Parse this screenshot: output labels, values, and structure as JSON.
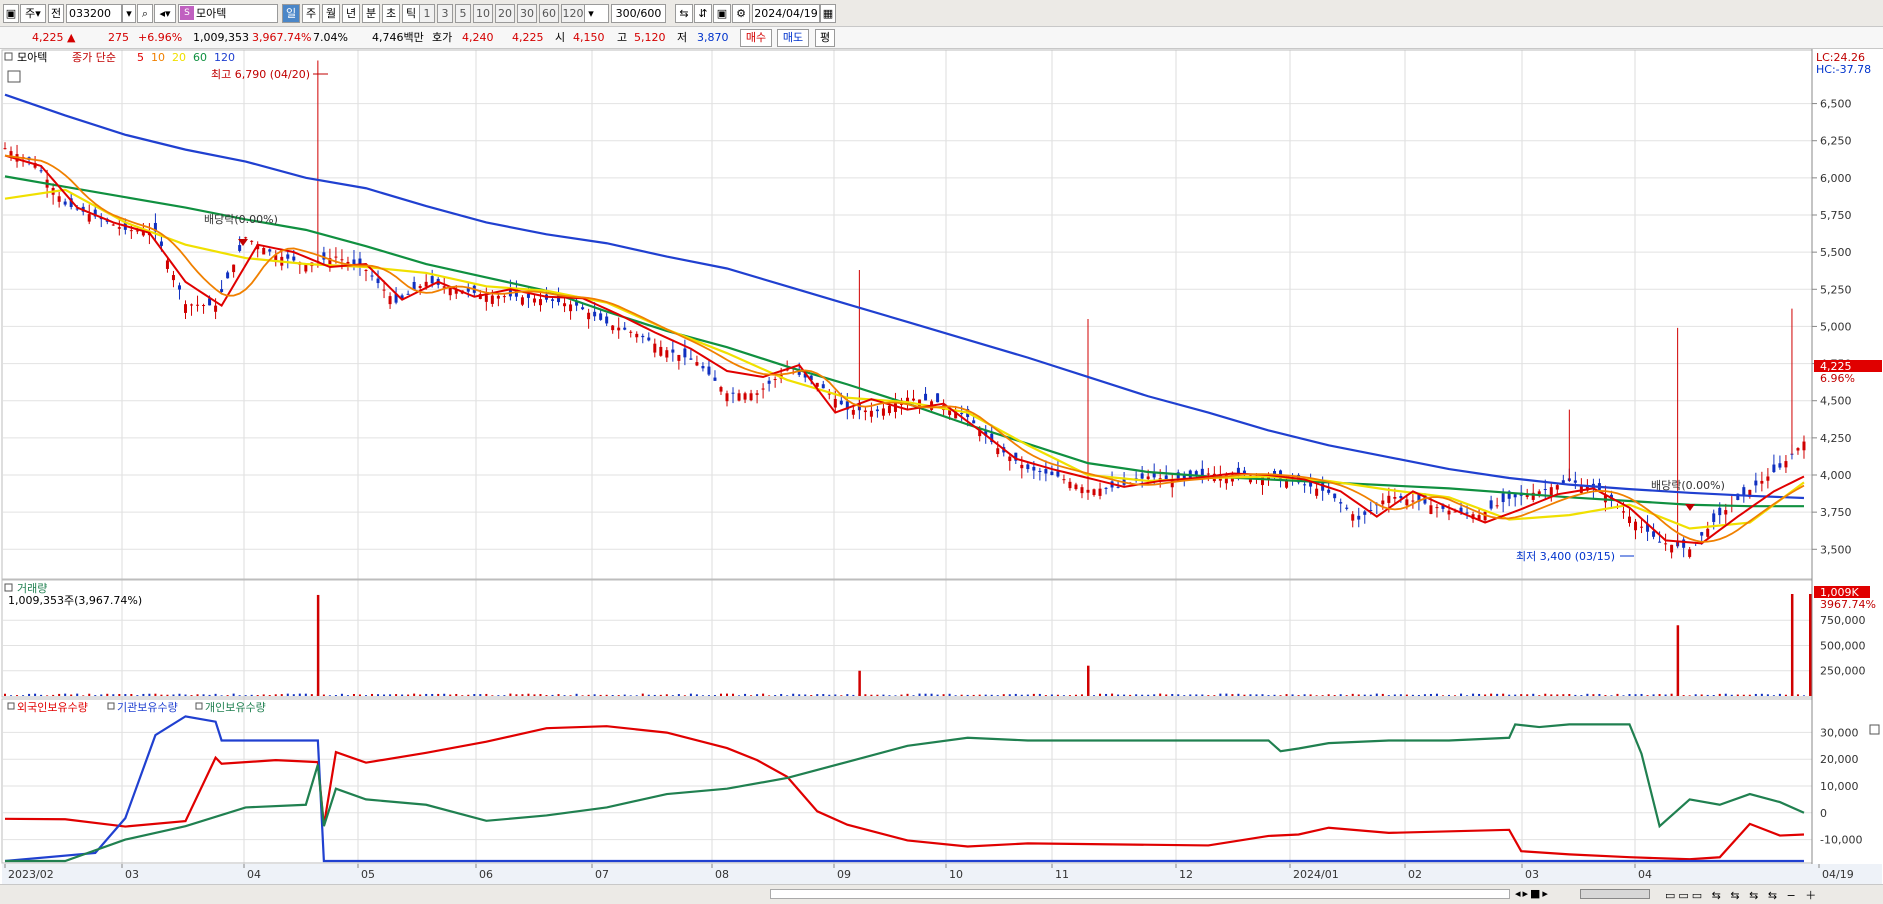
{
  "toolbar": {
    "period_type": "주",
    "all_label": "전",
    "code": "033200",
    "stock_name": "모아텍",
    "periods": [
      "일",
      "주",
      "월",
      "년",
      "분",
      "초",
      "틱"
    ],
    "active_period": "일",
    "intervals": [
      "1",
      "3",
      "5",
      "10",
      "20",
      "30",
      "60",
      "120"
    ],
    "count": "300/600",
    "date": "2024/04/19"
  },
  "info": {
    "price": "4,225",
    "change": "275",
    "change_pct": "+6.96%",
    "volume": "1,009,353",
    "volume_pct": "3,967.74%",
    "turnover": "7.04%",
    "amount": "4,746백만",
    "quote_label": "호가",
    "ask": "4,240",
    "bid": "4,225",
    "open_label": "시",
    "open": "4,150",
    "high_label": "고",
    "high": "5,120",
    "low_label": "저",
    "low": "3,870",
    "buy_label": "매수",
    "sell_label": "매도",
    "eval_label": "평"
  },
  "price_panel": {
    "stock": "모아텍",
    "ma_title": "종가 단순",
    "ma_periods": [
      "5",
      "10",
      "20",
      "60",
      "120"
    ],
    "ma_colors": [
      "#e00000",
      "#f08000",
      "#f0e000",
      "#109040",
      "#2040d0"
    ],
    "lc": "LC:24.26",
    "hc": "HC:-37.78",
    "current_tag": "4,225",
    "current_pct": "6.96%",
    "high_annot": "최고 6,790 (04/20)",
    "low_annot": "최저 3,400 (03/15)",
    "dividend1": "배당락(0.00%)",
    "dividend2": "배당락(0.00%)"
  },
  "volume_panel": {
    "title": "거래량",
    "subtitle": "1,009,353주(3,967.74%)",
    "current_tag": "1,009K",
    "current_pct": "3967.74%"
  },
  "holding_panel": {
    "legend": [
      "외국인보유수량",
      "기관보유수량",
      "개인보유수량"
    ],
    "colors": [
      "#e00000",
      "#2040d0",
      "#208050"
    ]
  },
  "chart_data": [
    {
      "type": "line",
      "title": "모아텍",
      "y_ticks": [
        "6,500",
        "6,250",
        "6,000",
        "5,750",
        "5,500",
        "5,250",
        "5,000",
        "4,750",
        "4,500",
        "4,250",
        "4,000",
        "3,750",
        "3,500"
      ],
      "ylim": [
        3300,
        6800
      ],
      "x_labels": [
        "2023/02",
        "03",
        "04",
        "05",
        "06",
        "07",
        "08",
        "09",
        "10",
        "11",
        "12",
        "2024/01",
        "02",
        "03",
        "04",
        "04/19"
      ],
      "series": [
        {
          "name": "120",
          "x": [
            0,
            10,
            20,
            30,
            40,
            50,
            60,
            70,
            80,
            90,
            100,
            110,
            120,
            130,
            140,
            150,
            160,
            170,
            180,
            190,
            200,
            210,
            220,
            230,
            240,
            250,
            260,
            270,
            280,
            290,
            299
          ],
          "values": [
            6560,
            6420,
            6290,
            6190,
            6110,
            6000,
            5930,
            5810,
            5700,
            5620,
            5560,
            5470,
            5390,
            5270,
            5150,
            5030,
            4910,
            4790,
            4660,
            4530,
            4420,
            4300,
            4200,
            4120,
            4040,
            3980,
            3935,
            3905,
            3880,
            3860,
            3845
          ]
        },
        {
          "name": "60",
          "x": [
            0,
            10,
            20,
            30,
            40,
            50,
            60,
            70,
            80,
            90,
            100,
            110,
            120,
            130,
            140,
            150,
            160,
            170,
            180,
            190,
            200,
            210,
            220,
            230,
            240,
            250,
            260,
            270,
            280,
            290,
            299
          ],
          "values": [
            6010,
            5940,
            5870,
            5800,
            5720,
            5650,
            5540,
            5420,
            5330,
            5240,
            5100,
            4970,
            4860,
            4730,
            4610,
            4480,
            4340,
            4210,
            4080,
            4020,
            3990,
            3970,
            3950,
            3930,
            3910,
            3880,
            3850,
            3825,
            3800,
            3790,
            3790
          ]
        },
        {
          "name": "20",
          "x": [
            0,
            10,
            20,
            30,
            40,
            50,
            60,
            70,
            80,
            90,
            100,
            110,
            120,
            130,
            140,
            150,
            160,
            170,
            180,
            190,
            200,
            210,
            220,
            230,
            240,
            250,
            260,
            270,
            280,
            290,
            299
          ],
          "values": [
            5860,
            5920,
            5700,
            5550,
            5460,
            5420,
            5400,
            5360,
            5270,
            5240,
            5160,
            4980,
            4820,
            4640,
            4520,
            4490,
            4420,
            4200,
            4000,
            3960,
            3980,
            3990,
            3960,
            3900,
            3850,
            3700,
            3730,
            3800,
            3640,
            3680,
            3950
          ]
        },
        {
          "name": "5",
          "x": [
            0,
            6,
            12,
            18,
            24,
            30,
            36,
            42,
            48,
            54,
            60,
            66,
            72,
            78,
            84,
            90,
            96,
            102,
            108,
            114,
            120,
            126,
            132,
            138,
            144,
            150,
            156,
            162,
            168,
            174,
            180,
            186,
            192,
            198,
            204,
            210,
            216,
            222,
            228,
            234,
            240,
            246,
            252,
            258,
            264,
            270,
            276,
            282,
            288,
            294,
            299
          ],
          "values": [
            6150,
            6080,
            5800,
            5700,
            5630,
            5300,
            5140,
            5550,
            5500,
            5400,
            5420,
            5180,
            5300,
            5200,
            5250,
            5200,
            5190,
            5080,
            4960,
            4850,
            4700,
            4660,
            4740,
            4420,
            4510,
            4440,
            4480,
            4300,
            4110,
            4040,
            3980,
            3920,
            3960,
            3980,
            4010,
            4000,
            3970,
            3890,
            3720,
            3890,
            3780,
            3680,
            3770,
            3870,
            3910,
            3780,
            3560,
            3540,
            3720,
            3890,
            3990
          ]
        },
        {
          "name": "close",
          "x": [
            0,
            5,
            10,
            15,
            20,
            25,
            30,
            35,
            40,
            45,
            50,
            55,
            60,
            65,
            70,
            75,
            80,
            85,
            90,
            95,
            100,
            105,
            110,
            115,
            120,
            125,
            130,
            135,
            140,
            145,
            150,
            155,
            160,
            165,
            170,
            175,
            180,
            185,
            190,
            195,
            200,
            205,
            210,
            215,
            220,
            225,
            230,
            235,
            240,
            245,
            250,
            255,
            260,
            265,
            270,
            275,
            280,
            285,
            290,
            295,
            299
          ],
          "values": [
            6200,
            6100,
            5820,
            5740,
            5650,
            5640,
            5150,
            5140,
            5600,
            5480,
            5420,
            5470,
            5380,
            5160,
            5300,
            5250,
            5210,
            5200,
            5180,
            5140,
            5020,
            4950,
            4840,
            4760,
            4550,
            4550,
            4710,
            4620,
            4440,
            4430,
            4520,
            4490,
            4390,
            4180,
            4040,
            3990,
            3900,
            3920,
            3990,
            3960,
            4010,
            4000,
            3990,
            3950,
            3880,
            3700,
            3860,
            3820,
            3760,
            3730,
            3840,
            3890,
            3960,
            3900,
            3720,
            3550,
            3500,
            3730,
            3900,
            4050,
            4225
          ]
        }
      ]
    },
    {
      "type": "bar",
      "title": "거래량",
      "y_ticks": [
        "750,000",
        "500,000",
        "250,000"
      ],
      "ylim": [
        0,
        1009353
      ],
      "x": [
        52,
        142,
        180,
        278,
        297,
        300
      ],
      "values": [
        1000000,
        250000,
        300000,
        700000,
        1009353,
        1009353
      ],
      "baseline_value": 20000
    },
    {
      "type": "line",
      "title": "외국인보유수량 / 기관보유수량 / 개인보유수량",
      "y_ticks": [
        "30,000",
        "20,000",
        "10,000",
        "0",
        "-10,000"
      ],
      "ylim": [
        -18000,
        38000
      ],
      "series": [
        {
          "name": "외국인보유수량",
          "x": [
            0,
            10,
            20,
            30,
            35,
            36,
            45,
            52,
            53,
            55,
            60,
            70,
            80,
            90,
            100,
            110,
            120,
            125,
            130,
            135,
            140,
            150,
            160,
            170,
            200,
            210,
            215,
            220,
            230,
            250,
            252,
            260,
            270,
            280,
            285,
            290,
            295,
            299
          ],
          "values": [
            -3000,
            -2000,
            -5000,
            -3000,
            20000,
            19000,
            20000,
            19000,
            -5000,
            22000,
            19000,
            22000,
            26000,
            31000,
            32000,
            30000,
            24000,
            19000,
            14000,
            0,
            -5000,
            -10000,
            -12000,
            -12000,
            -12000,
            -9000,
            -8000,
            -6000,
            -7000,
            -7000,
            -15000,
            -16000,
            -17000,
            -17000,
            -16000,
            -4000,
            -8000,
            -8000
          ]
        },
        {
          "name": "기관보유수량",
          "x": [
            0,
            15,
            20,
            25,
            30,
            35,
            36,
            52,
            53,
            60,
            100,
            200,
            270,
            275,
            276,
            280,
            299
          ],
          "values": [
            -18000,
            -15000,
            -2000,
            29000,
            36000,
            34000,
            27000,
            27000,
            -18000,
            -18000,
            -18000,
            -18000,
            -18000,
            -18000,
            -18000,
            -18000,
            -18000
          ]
        },
        {
          "name": "개인보유수량",
          "x": [
            0,
            10,
            20,
            30,
            40,
            50,
            52,
            53,
            55,
            60,
            70,
            80,
            90,
            100,
            110,
            120,
            130,
            140,
            150,
            160,
            170,
            180,
            200,
            210,
            212,
            215,
            220,
            230,
            240,
            250,
            251,
            255,
            260,
            270,
            272,
            275,
            280,
            285,
            290,
            295,
            299
          ],
          "values": [
            -18000,
            -18000,
            -10000,
            -5000,
            2000,
            3000,
            18000,
            -5000,
            9000,
            5000,
            3000,
            -3000,
            -1000,
            2000,
            7000,
            9000,
            13000,
            19000,
            25000,
            28000,
            27000,
            27000,
            27000,
            27000,
            23000,
            24000,
            26000,
            27000,
            27000,
            28000,
            33000,
            32000,
            33000,
            33000,
            22000,
            -5000,
            5000,
            3000,
            7000,
            4000,
            0
          ]
        }
      ]
    }
  ]
}
